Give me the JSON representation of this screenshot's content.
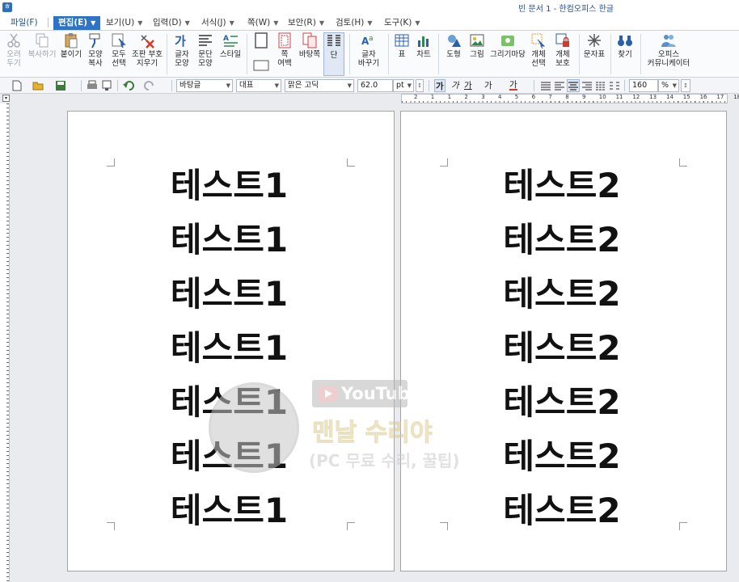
{
  "window": {
    "title": "빈 문서 1 - 한컴오피스 한글",
    "app_icon": "hwp-app-icon"
  },
  "menu": {
    "items": [
      {
        "label": "파일(F)",
        "has_arrow": false
      },
      {
        "label": "편집(E)",
        "has_arrow": true,
        "active": true
      },
      {
        "label": "보기(U)",
        "has_arrow": true
      },
      {
        "label": "입력(D)",
        "has_arrow": true
      },
      {
        "label": "서식(J)",
        "has_arrow": true
      },
      {
        "label": "쪽(W)",
        "has_arrow": true
      },
      {
        "label": "보안(R)",
        "has_arrow": true
      },
      {
        "label": "검토(H)",
        "has_arrow": true
      },
      {
        "label": "도구(K)",
        "has_arrow": true
      }
    ]
  },
  "ribbon": {
    "buttons": [
      {
        "label": "오려\n두기",
        "icon": "scissors-icon",
        "disabled": true
      },
      {
        "label": "복사하기",
        "icon": "copy-icon",
        "disabled": true
      },
      {
        "label": "붙이기",
        "icon": "paste-icon"
      },
      {
        "label": "모양\n복사",
        "icon": "format-painter-icon"
      },
      {
        "label": "모두\n선택",
        "icon": "select-all-icon"
      },
      {
        "label": "조판 부호\n지우기",
        "icon": "clear-codes-icon"
      },
      {
        "label": "글자\n모양",
        "icon": "char-shape-icon"
      },
      {
        "label": "문단\n모양",
        "icon": "paragraph-shape-icon"
      },
      {
        "label": "스타일",
        "icon": "style-icon"
      },
      {
        "label": "쪽\n여백",
        "icon": "page-margin-icon"
      },
      {
        "label": "바탕쪽",
        "icon": "master-page-icon"
      },
      {
        "label": "단",
        "icon": "columns-icon",
        "pressed": true
      },
      {
        "label": "글자\n바꾸기",
        "icon": "change-char-icon"
      },
      {
        "label": "표",
        "icon": "table-icon"
      },
      {
        "label": "차트",
        "icon": "chart-icon"
      },
      {
        "label": "도형",
        "icon": "shape-icon"
      },
      {
        "label": "그림",
        "icon": "picture-icon"
      },
      {
        "label": "그리기마당",
        "icon": "drawing-gallery-icon"
      },
      {
        "label": "개체\n선택",
        "icon": "object-select-icon"
      },
      {
        "label": "개체\n보호",
        "icon": "object-protect-icon"
      },
      {
        "label": "문자표",
        "icon": "symbol-icon"
      },
      {
        "label": "찾기",
        "icon": "binoculars-icon"
      },
      {
        "label": "오피스\n커뮤니케이터",
        "icon": "communicator-icon"
      }
    ]
  },
  "toolbar": {
    "style_name": "바탕글",
    "font_lang": "대표",
    "font_name": "맑은 고딕",
    "font_size": "62.0",
    "font_unit": "pt",
    "zoom": "160",
    "zoom_unit": "%",
    "char_buttons": [
      "가",
      "가",
      "가",
      "가",
      "가"
    ]
  },
  "ruler": {
    "labels": [
      "2",
      "1",
      "1",
      "2",
      "3",
      "4",
      "5",
      "6",
      "7",
      "8",
      "9",
      "10",
      "11",
      "12",
      "13",
      "14",
      "15",
      "16",
      "17",
      "18"
    ]
  },
  "pages": [
    {
      "lines": [
        "테스트1",
        "테스트1",
        "테스트1",
        "테스트1",
        "테스트1",
        "테스트1",
        "테스트1"
      ]
    },
    {
      "lines": [
        "테스트2",
        "테스트2",
        "테스트2",
        "테스트2",
        "테스트2",
        "테스트2",
        "테스트2"
      ]
    }
  ],
  "watermark": {
    "badge": "YouTube",
    "title": "맨날 수리야",
    "subtitle": "(PC 무료 수리, 꿀팁)"
  }
}
